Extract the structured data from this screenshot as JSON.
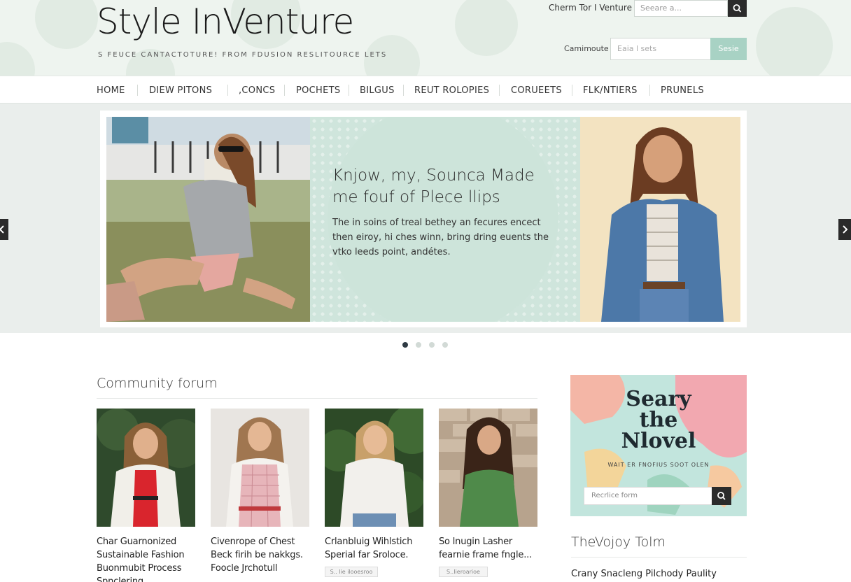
{
  "header": {
    "site_title": "Style InVenture",
    "tagline": "S FEUCE  CANTACTOTURE!  FROM  FDUSION  RESLITOURCE  LETS",
    "top_link": "Cherm Tor I Venture",
    "top_search_placeholder": "Seeare a...",
    "subscribe_label": "Camimoute",
    "email_placeholder": "Eaia l sets",
    "email_button": "Sesie"
  },
  "nav": {
    "items": [
      "HOME",
      "DIEW PITONS",
      ",CONCS",
      "POCHETS",
      "BILGUS",
      "REUT ROLOPIES",
      "CORUEETS",
      "FLK/NTIERS",
      "PRUNELS"
    ]
  },
  "hero": {
    "headline": "Knjow, my, Sounca Made me fouf of Plece llips",
    "body": "The in soins of treal bethey an fecures encect then eiroy, hi ches winn, bring dring euents the vtko leeds point, andétes.",
    "slide_count": 4,
    "active_slide": 1
  },
  "community": {
    "title": "Community forum",
    "posts": [
      {
        "title": "Char Guarnonized Sustainable Fashion Buonmubit Process Spnclering",
        "tag": ""
      },
      {
        "title": "Civenrope of Chest Beck firih be nakkgs. Foocle Jrchotull",
        "tag": ""
      },
      {
        "title": "Crlanbluig Wihlstich Sperial far Sroloce.",
        "tag": "S.. lie ilooesroo"
      },
      {
        "title": "So lnugin Lasher fearnie frame fngle...",
        "tag": "S..Iieroarioe"
      }
    ]
  },
  "sidebar": {
    "card_title_lines": [
      "Seary",
      "the",
      "Nlovel"
    ],
    "card_subtitle": "WAIT ER FNOFIUS SOOT OLEN",
    "card_search_placeholder": "Recrlice form",
    "section_title": "TheVojoy Tolm",
    "first_item": "Crany Snacleng Pilchody Paulity"
  },
  "colors": {
    "header_bg": "#eef4ef",
    "accent_mint": "#a8d2c4",
    "dark_button": "#2b2b2b",
    "hero_center_bg": "#cfe5dc"
  },
  "icons": {
    "search": "search-icon",
    "prev": "chevron-left-icon",
    "next": "chevron-right-icon"
  }
}
